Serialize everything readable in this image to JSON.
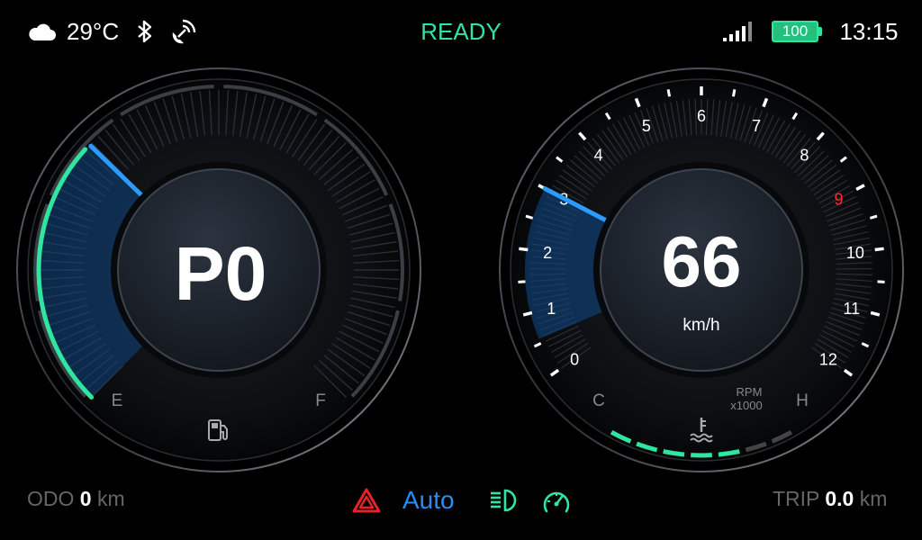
{
  "status_bar": {
    "temperature": "29°C",
    "ready_label": "READY",
    "battery_level": "100",
    "time": "13:15",
    "colors": {
      "ready": "#2fe5a0",
      "battery": "#22c07c"
    }
  },
  "fuel_gauge": {
    "gear_display": "P0",
    "empty_label": "E",
    "full_label": "F",
    "icon": "fuel-pump-icon",
    "fuel_level_fraction": 0.33
  },
  "speedometer": {
    "speed": "66",
    "unit": "km/h",
    "rpm_label_1": "RPM",
    "rpm_label_2": "x1000",
    "rpm_ticks": [
      "0",
      "1",
      "2",
      "3",
      "4",
      "5",
      "6",
      "7",
      "8",
      "9",
      "10",
      "11",
      "12"
    ],
    "redline_tick": "9",
    "rpm_value": 3,
    "coolant_cold_label": "C",
    "coolant_hot_label": "H",
    "coolant_icon": "coolant-temperature-icon",
    "coolant_level_fraction": 0.72,
    "colors": {
      "needle": "#2b9bff",
      "redline": "#ff2a2a",
      "coolant": "#2fe5a0"
    }
  },
  "bottom_bar": {
    "odo_label": "ODO",
    "odo_value": "0",
    "odo_unit": "km",
    "trip_label": "TRIP",
    "trip_value": "0.0",
    "trip_unit": "km",
    "drive_mode": "Auto",
    "indicators": [
      "hazard-warning-icon",
      "headlight-icon",
      "speed-warning-icon"
    ],
    "colors": {
      "hazard": "#e8222a",
      "auto": "#2b8cf0",
      "headlight": "#2fe5a0",
      "speed_warning": "#2fe5a0"
    }
  }
}
